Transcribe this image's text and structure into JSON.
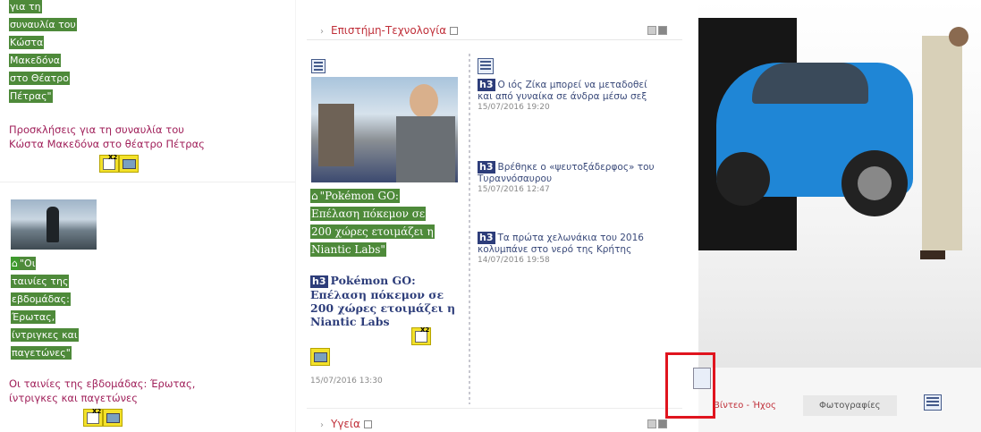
{
  "left": {
    "item1_highlight_lines": [
      "για τη",
      "συναυλία του",
      "Κώστα",
      "Μακεδόνα",
      "στο Θέατρο",
      "Πέτρας\""
    ],
    "item1_caption": "Προσκλήσεις για τη συναυλία του Κώστα Μακεδόνα στο θέατρο Πέτρας",
    "item2_highlight_lines": [
      "\"Οι",
      "ταινίες της",
      "εβδομάδας:",
      "Έρωτας,",
      "ίντριγκες και",
      "παγετώνες\""
    ],
    "item2_caption": "Οι ταινίες της εβδομάδας: Έρωτας, ίντριγκες και παγετώνες"
  },
  "middle": {
    "section_title": "Επιστήμη-Τεχνολογία",
    "feature_highlight_lines": [
      "\"Pokémon GO:",
      "Επέλαση πόκεμον σε",
      "200 χώρες ετοιμάζει η",
      "Niantic Labs\""
    ],
    "feature_h3": "h3",
    "feature_title": "Pokémon GO: Επέλαση πόκεμον σε 200 χώρες ετοιμάζει η Niantic Labs",
    "feature_date": "15/07/2016 13:30",
    "news": [
      {
        "tag": "h3",
        "title": "Ο ιός Ζίκα μπορεί να μεταδοθεί και από γυναίκα σε άνδρα μέσω σεξ",
        "date": "15/07/2016 19:20"
      },
      {
        "tag": "h3",
        "title": "Βρέθηκε ο «ψευτοξάδερφος» του Τυραννόσαυρου",
        "date": "15/07/2016 12:47"
      },
      {
        "tag": "h3",
        "title": "Τα πρώτα χελωνάκια του 2016 κολυμπάνε στο νερό της Κρήτης",
        "date": "14/07/2016 19:58"
      }
    ],
    "section2_title": "Υγεία"
  },
  "right": {
    "tab_video": "Βίντεο - Ήχος",
    "tab_photos": "Φωτογραφίες"
  },
  "colors": {
    "highlight": "#4e8a3a",
    "accent": "#c0303a",
    "badge": "#f3e12a",
    "selection": "#e0141e"
  }
}
